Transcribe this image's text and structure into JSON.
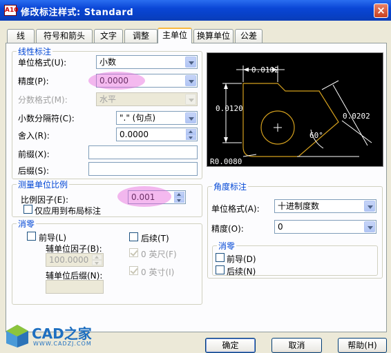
{
  "window": {
    "app_icon": "A10",
    "title": "修改标注样式: Standard",
    "close": "×"
  },
  "tabs": [
    "线",
    "符号和箭头",
    "文字",
    "调整",
    "主单位",
    "换算单位",
    "公差"
  ],
  "linear": {
    "legend": "线性标注",
    "unit_format_label": "单位格式(U):",
    "unit_format_value": "小数",
    "precision_label": "精度(P):",
    "precision_value": "0.0000",
    "fraction_format_label": "分数格式(M):",
    "fraction_format_value": "水平",
    "decimal_sep_label": "小数分隔符(C):",
    "decimal_sep_value": "\".\" (句点)",
    "round_off_label": "舍入(R):",
    "round_off_value": "0.0000",
    "prefix_label": "前缀(X):",
    "prefix_value": "",
    "suffix_label": "后缀(S):",
    "suffix_value": ""
  },
  "scale": {
    "legend": "测量单位比例",
    "factor_label": "比例因子(E):",
    "factor_value": "0.001",
    "layout_only_label": "仅应用到布局标注"
  },
  "zero_suppress": {
    "legend": "消零",
    "leading_label": "前导(L)",
    "sub_unit_factor_label": "辅单位因子(B):",
    "sub_unit_factor_value": "100.0000",
    "sub_unit_suffix_label": "辅单位后缀(N):",
    "sub_unit_suffix_value": "",
    "trailing_label": "后续(T)",
    "feet_label": "0 英尺(F)",
    "inches_label": "0 英寸(I)"
  },
  "angular": {
    "legend": "角度标注",
    "unit_format_label": "单位格式(A):",
    "unit_format_value": "十进制度数",
    "precision_label": "精度(O):",
    "precision_value": "0",
    "zero_legend": "消零",
    "leading_label": "前导(D)",
    "trailing_label": "后续(N)"
  },
  "preview": {
    "dim_top": "0.0102",
    "dim_left": "0.0120",
    "dim_right": "0.0202",
    "angle": "60°",
    "radius": "R0.0080"
  },
  "buttons": {
    "ok": "确定",
    "cancel": "取消",
    "help": "帮助(H)"
  },
  "watermark": {
    "brand": "CAD之家",
    "url": "WWW.CADZJ.COM"
  },
  "colors": {
    "title_bar": "#0a46d6",
    "preview_bg": "#000000",
    "preview_lines": "#d4a01e",
    "highlight": "#e664dc"
  }
}
